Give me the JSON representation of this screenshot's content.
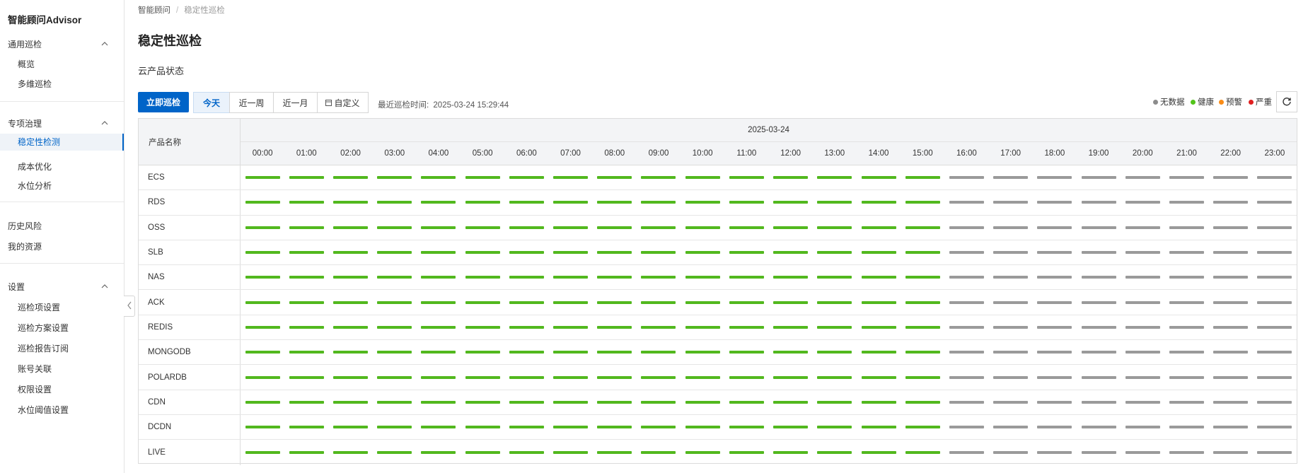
{
  "sidebar": {
    "brand": "智能顾问Advisor",
    "sections": [
      {
        "title": "通用巡检",
        "items": [
          "概览",
          "多维巡检"
        ]
      },
      {
        "title": "专项治理",
        "items": [
          "稳定性检测",
          "成本优化",
          "水位分析"
        ]
      },
      {
        "title": "历史风险"
      },
      {
        "title": "我的资源"
      },
      {
        "title": "设置",
        "items": [
          "巡检项设置",
          "巡检方案设置",
          "巡检报告订阅",
          "账号关联",
          "权限设置",
          "水位阈值设置"
        ]
      }
    ],
    "active_item": "稳定性检测"
  },
  "breadcrumb": {
    "root": "智能顾问",
    "current": "稳定性巡检"
  },
  "page_title": "稳定性巡检",
  "section_title": "云产品状态",
  "toolbar": {
    "run_button": "立即巡检",
    "ranges": [
      "今天",
      "近一周",
      "近一月",
      "自定义"
    ],
    "active_range": "今天",
    "last_time_label": "最近巡检时间:",
    "last_time_value": "2025-03-24 15:29:44"
  },
  "legend": [
    {
      "label": "无数据",
      "color": "#8c8c8c"
    },
    {
      "label": "健康",
      "color": "#52c41a"
    },
    {
      "label": "预警",
      "color": "#fa8c16"
    },
    {
      "label": "严重",
      "color": "#e02020"
    }
  ],
  "colors": {
    "healthy": "#52b81e",
    "nodata": "#9a9a9a",
    "primary": "#0064c8"
  },
  "table": {
    "name_header": "产品名称",
    "date": "2025-03-24",
    "hours": [
      "00:00",
      "01:00",
      "02:00",
      "03:00",
      "04:00",
      "05:00",
      "06:00",
      "07:00",
      "08:00",
      "09:00",
      "10:00",
      "11:00",
      "12:00",
      "13:00",
      "14:00",
      "15:00",
      "16:00",
      "17:00",
      "18:00",
      "19:00",
      "20:00",
      "21:00",
      "22:00",
      "23:00"
    ],
    "healthy_hours_count": 16,
    "products": [
      "ECS",
      "RDS",
      "OSS",
      "SLB",
      "NAS",
      "ACK",
      "REDIS",
      "MONGODB",
      "POLARDB",
      "CDN",
      "DCDN",
      "LIVE"
    ]
  }
}
